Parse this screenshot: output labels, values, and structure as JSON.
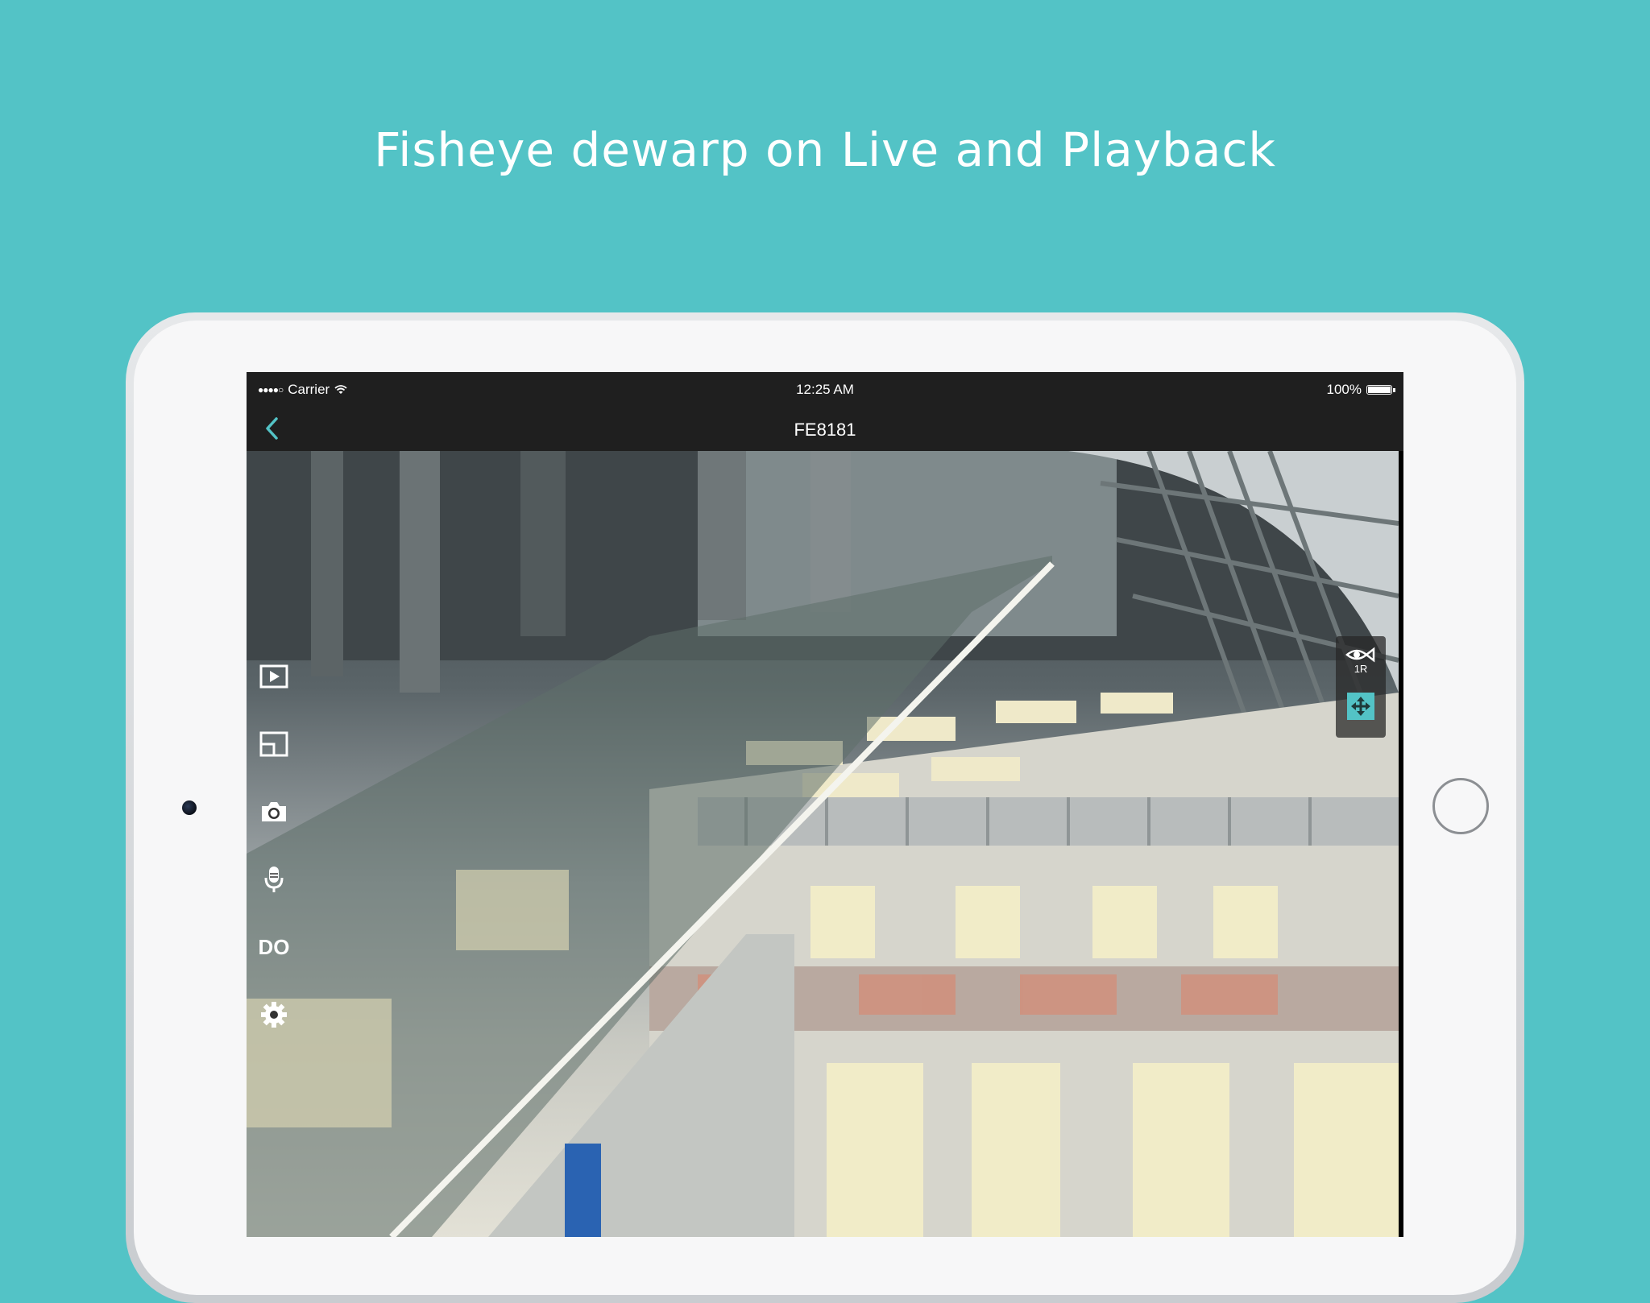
{
  "headline": "Fisheye dewarp on Live and Playback",
  "status_bar": {
    "signal": "●●●●○",
    "carrier": "Carrier",
    "time": "12:25 AM",
    "battery": "100%"
  },
  "nav": {
    "title": "FE8181",
    "back_icon": "chevron-left-icon"
  },
  "toolbar": {
    "items": [
      {
        "icon": "playback-icon"
      },
      {
        "icon": "layout-icon"
      },
      {
        "icon": "snapshot-camera-icon"
      },
      {
        "icon": "microphone-icon"
      },
      {
        "label": "DO"
      },
      {
        "icon": "gear-icon"
      }
    ]
  },
  "fisheye_panel": {
    "mode_icon": "fisheye-eye-icon",
    "mode_label": "1R",
    "ptz_icon": "move-arrows-icon"
  },
  "colors": {
    "background": "#53c3c6",
    "accent": "#53c3c6",
    "bar": "#1f1f1f"
  }
}
